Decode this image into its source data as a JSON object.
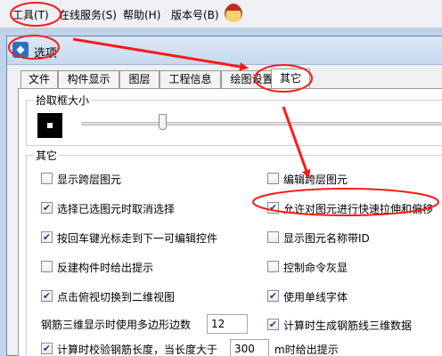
{
  "menubar": {
    "items": [
      "工具(T)",
      "在线服务(S)",
      "帮助(H)",
      "版本号(B)"
    ]
  },
  "dialog": {
    "title": "选项",
    "tabs": [
      "文件",
      "构件显示",
      "图层",
      "工程信息",
      "绘图设置",
      "其它"
    ],
    "active_tab": "其它",
    "pick_group": {
      "label": "拾取框大小",
      "slider_value": 0.22
    },
    "other_group": {
      "label": "其它",
      "left_options": [
        {
          "label": "显示跨层图元",
          "checked": false
        },
        {
          "label": "选择已选图元时取消选择",
          "checked": true
        },
        {
          "label": "按回车键光标走到下一可编辑控件",
          "checked": true
        },
        {
          "label": "反建构件时给出提示",
          "checked": false
        },
        {
          "label": "点击俯视切换到二维视图",
          "checked": true
        }
      ],
      "right_options": [
        {
          "label": "编辑跨层图元",
          "checked": false
        },
        {
          "label": "允许对图元进行快速拉伸和偏移",
          "checked": true
        },
        {
          "label": "显示图元名称带ID",
          "checked": false
        },
        {
          "label": "控制命令灰显",
          "checked": false
        },
        {
          "label": "使用单线字体",
          "checked": true
        },
        {
          "label": "计算时生成钢筋线三维数据",
          "checked": true
        }
      ],
      "polygon_edges_label": "钢筋三维显示时使用多边形边数",
      "polygon_edges_value": "12",
      "length_check": {
        "label": "计算时校验钢筋长度，当长度大于",
        "checked": true,
        "value": "300",
        "suffix": "m时给出提示"
      }
    }
  },
  "colors": {
    "annotation_red": "#ff1a1a",
    "window_blue": "#2a6fc2"
  },
  "icons": {
    "app": "app-icon",
    "menu_extra": "mascot-icon"
  }
}
